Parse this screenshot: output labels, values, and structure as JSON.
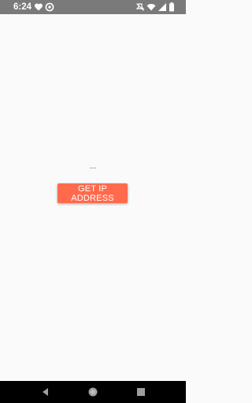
{
  "status_bar": {
    "time": "6:24",
    "left_icons": [
      "heart-icon",
      "circle-at-icon"
    ],
    "right_icons": [
      "do-not-disturb-off-icon",
      "wifi-icon",
      "signal-icon",
      "battery-icon"
    ],
    "background": "#7a7a7a"
  },
  "main": {
    "result_text": "...",
    "button_label": "GET IP ADDRESS",
    "button_color": "#ff6a4d"
  },
  "nav_bar": {
    "buttons": [
      "back-icon",
      "home-icon",
      "recents-icon"
    ]
  }
}
